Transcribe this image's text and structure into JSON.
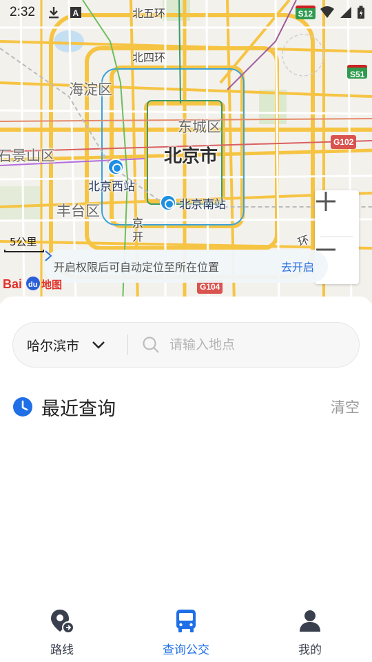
{
  "status_bar": {
    "time": "2:32",
    "highway_badge": "S12"
  },
  "map": {
    "districts": {
      "haidian": "海淀区",
      "dongcheng": "东城区",
      "shijingshan": "石景山区",
      "fengtai": "丰台区"
    },
    "city": "北京市",
    "rings": {
      "north5": "北五环",
      "north4": "北四环",
      "east_fragment": "环"
    },
    "stations": {
      "west": "北京西站",
      "south": "北京南站"
    },
    "road_vertical": "京开",
    "highway_badges": {
      "s51": "S51",
      "g102": "G102",
      "g104": "G104"
    },
    "scale_text": "5公里",
    "logo_text": "Baidu地图"
  },
  "location_banner": {
    "text": "开启权限后可自动定位至所在位置",
    "action": "去开启"
  },
  "search": {
    "city": "哈尔滨市",
    "placeholder": "请输入地点"
  },
  "recent": {
    "title": "最近查询",
    "clear": "清空"
  },
  "bottom_nav": {
    "items": [
      {
        "label": "路线",
        "icon": "route-pin-icon",
        "active": false
      },
      {
        "label": "查询公交",
        "icon": "bus-icon",
        "active": true
      },
      {
        "label": "我的",
        "icon": "user-icon",
        "active": false
      }
    ]
  },
  "colors": {
    "accent": "#1f6fe6",
    "link": "#2a6fe0",
    "station": "#1e8fe1",
    "road_major": "#f6c443",
    "nav_inactive": "#3a3f4d"
  }
}
